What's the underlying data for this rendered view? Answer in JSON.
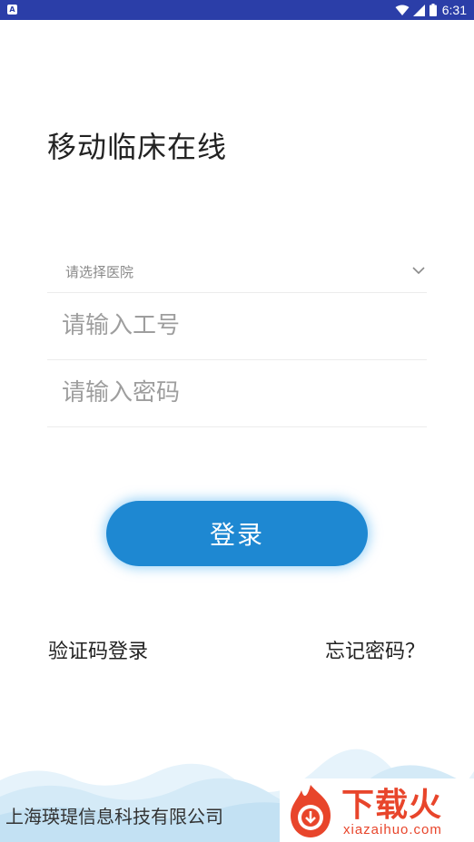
{
  "status_bar": {
    "app_icon": "A",
    "time": "6:31",
    "icons": [
      "wifi-icon",
      "signal-icon",
      "battery-icon"
    ]
  },
  "app": {
    "title": "移动临床在线"
  },
  "form": {
    "hospital_select_label": "请选择医院",
    "employee_placeholder": "请输入工号",
    "password_placeholder": "请输入密码",
    "login_label": "登录"
  },
  "links": {
    "sms_login": "验证码登录",
    "forgot_password": "忘记密码？"
  },
  "footer": {
    "company": "上海瑛瑅信息科技有限公司",
    "watermark_text": "下载火",
    "watermark_sub": "xiazaihuo.com"
  },
  "colors": {
    "status_bar": "#2b3ea8",
    "primary": "#1e88d2",
    "watermark": "#e8452b"
  }
}
